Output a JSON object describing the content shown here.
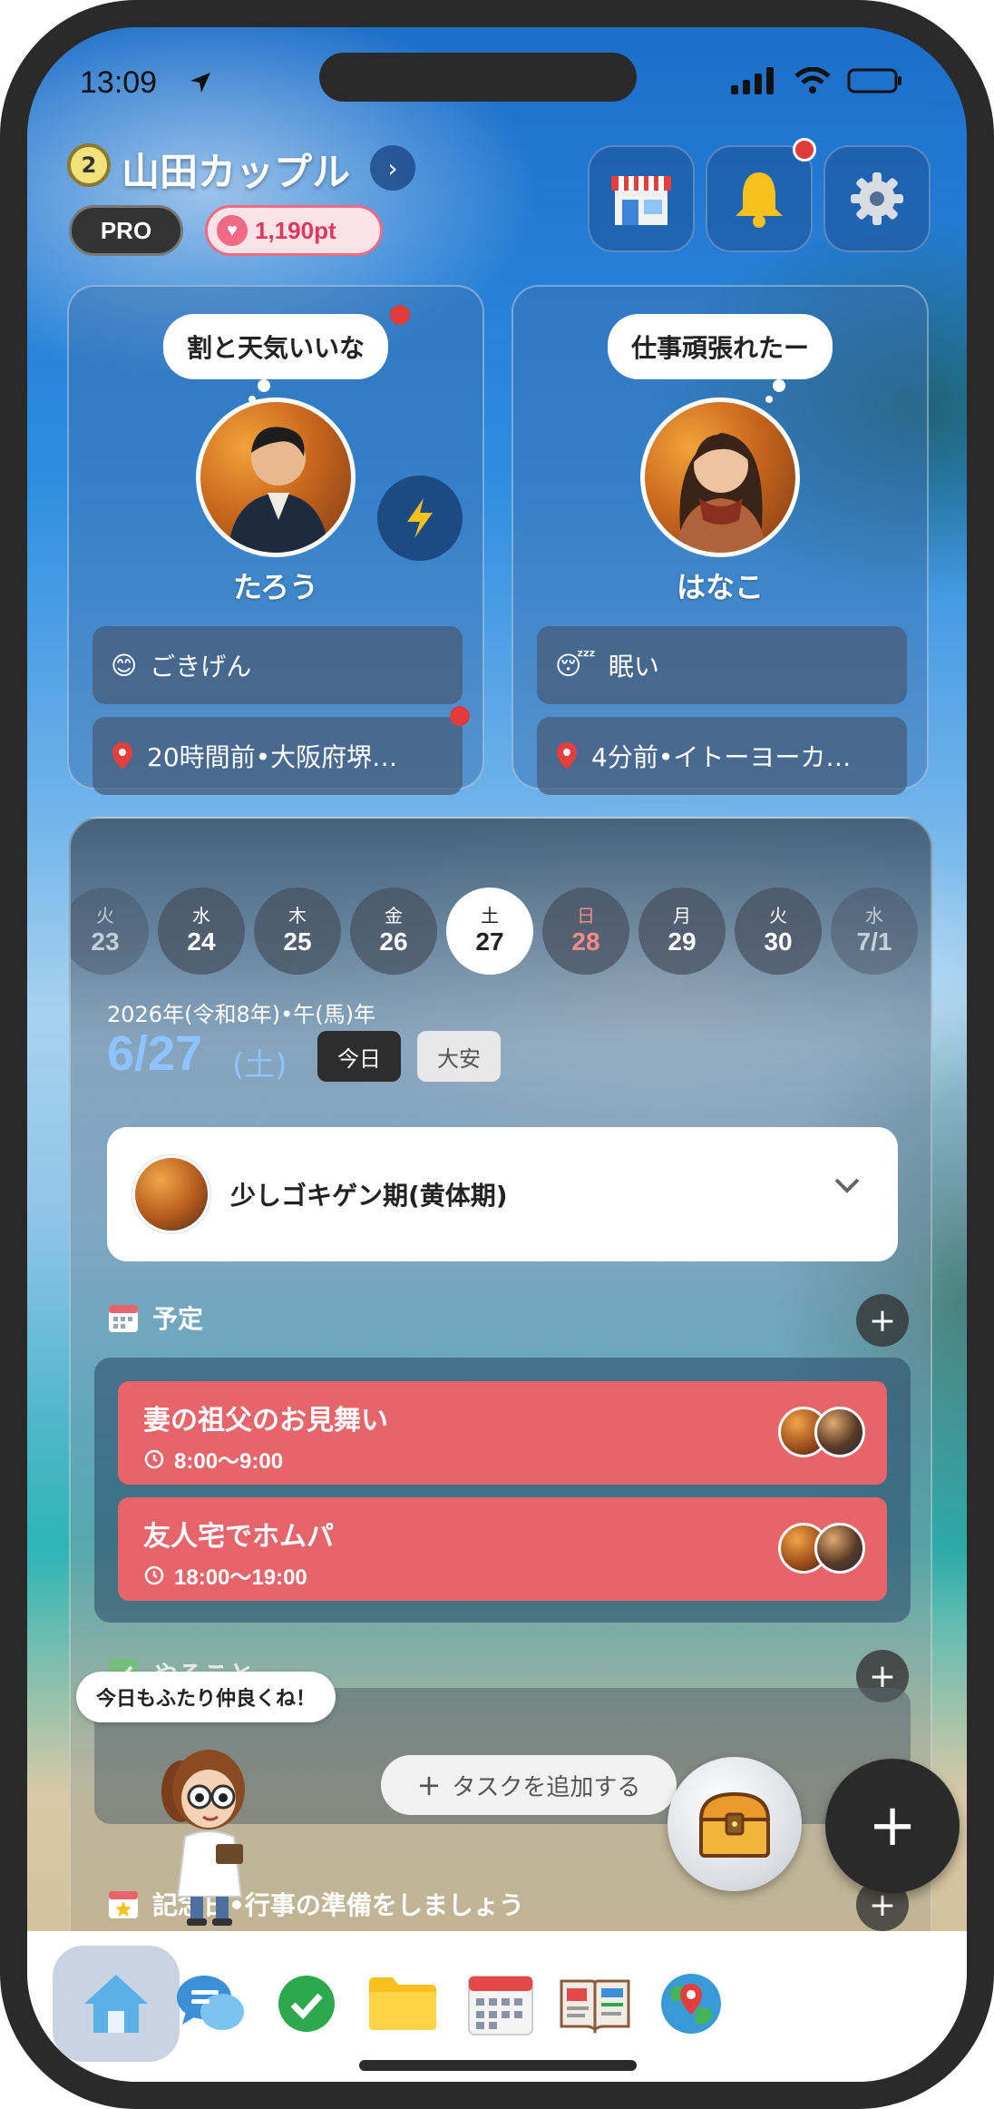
{
  "status_bar": {
    "time": "13:09"
  },
  "header": {
    "level": "2",
    "couple_name": "山田カップル",
    "pro_label": "PRO",
    "points": "1,190pt",
    "icons": [
      "shop-icon",
      "bell-icon",
      "settings-icon"
    ]
  },
  "partners": [
    {
      "name": "たろう",
      "bubble": "割と天気いいな",
      "mood_emoji": "😊",
      "mood": "ごきげん",
      "location": "20時間前•大阪府堺…"
    },
    {
      "name": "はなこ",
      "bubble": "仕事頑張れたー",
      "mood_emoji": "😴",
      "mood": "眠い",
      "location": "4分前•イトーヨーカ…"
    }
  ],
  "calendar": {
    "days": [
      {
        "dow": "火",
        "num": "23"
      },
      {
        "dow": "水",
        "num": "24"
      },
      {
        "dow": "木",
        "num": "25"
      },
      {
        "dow": "金",
        "num": "26"
      },
      {
        "dow": "土",
        "num": "27"
      },
      {
        "dow": "日",
        "num": "28"
      },
      {
        "dow": "月",
        "num": "29"
      },
      {
        "dow": "火",
        "num": "30"
      },
      {
        "dow": "水",
        "num": "7/1"
      }
    ],
    "era": "2026年(令和8年)•午(馬)年",
    "date": "6/27",
    "dow": "(土)",
    "today_label": "今日",
    "rokuyo": "大安"
  },
  "mood_card": {
    "text": "少しゴキゲン期(黄体期)"
  },
  "schedule": {
    "title": "予定",
    "events": [
      {
        "title": "妻の祖父のお見舞い",
        "time": "8:00〜9:00"
      },
      {
        "title": "友人宅でホムパ",
        "time": "18:00〜19:00"
      }
    ]
  },
  "todo": {
    "title": "やること",
    "add_label": "タスクを追加する"
  },
  "anniversary": {
    "title": "記念日•行事の準備をしましょう"
  },
  "mascot_speech": "今日もふたり仲良くね！",
  "colors": {
    "event": "#e8646b",
    "accent_blue": "#8fc3ff",
    "sunday": "#ff8a8a"
  }
}
